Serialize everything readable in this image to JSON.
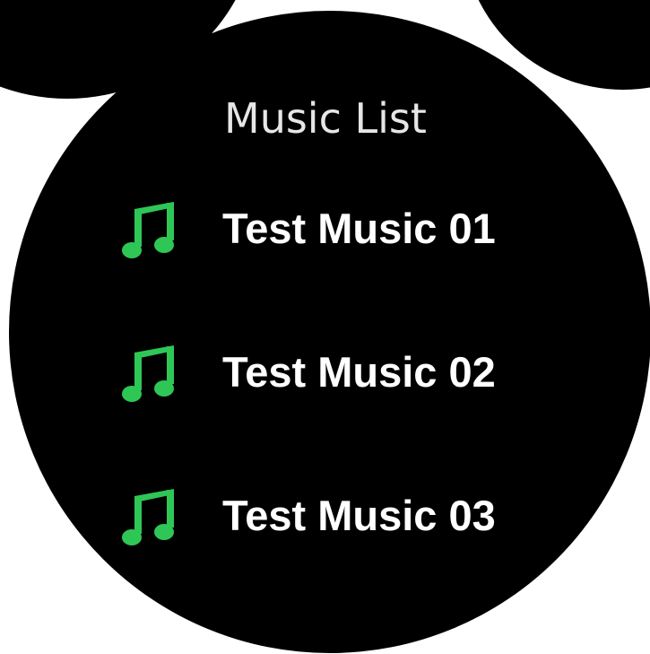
{
  "screen": {
    "title": "Music List",
    "accent_color": "#2ec756",
    "background_color": "#000000",
    "item_icon": "music-note-icon"
  },
  "music_list": {
    "items": [
      {
        "label": "Test Music 01"
      },
      {
        "label": "Test Music 02"
      },
      {
        "label": "Test Music 03"
      }
    ]
  }
}
